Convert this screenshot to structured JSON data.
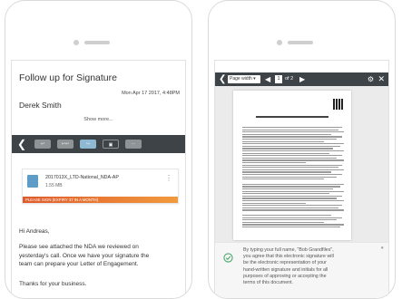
{
  "email": {
    "subject": "Follow up for Signature",
    "date": "Mon Apr 17 2017, 4:48PM",
    "sender": "Derek Smith",
    "show_more": "Show more...",
    "attachment": {
      "name": "2017013X_LTD-National_NDA-AP",
      "size": "1.55 MB",
      "banner": "PLEASE SIGN (EXPIRY 37 IN A MONTH)"
    },
    "greeting": "Hi Andreas,",
    "body_lines": [
      "Please see attached the NDA we reviewed on",
      "yesterday's call. Once we have your signature the",
      "team can prepare your Letter of Engagement."
    ],
    "closing": "Thanks for your business."
  },
  "viewer": {
    "page_width_label": "Page width",
    "page_number": "1",
    "page_of": "of 2",
    "agreement_lines": [
      "By typing your full name, \"Bob Grandfiles\",",
      "you agree that this electronic signature will",
      "be the electronic representation of your",
      "hand-written signature and initials for all",
      "purposes of approving or accepting the",
      "terms of this document."
    ]
  },
  "colors": {
    "toolbar": "#3e4348",
    "banner": "#e05a2b",
    "accent": "#5f9dc8",
    "check": "#4aa86a"
  }
}
